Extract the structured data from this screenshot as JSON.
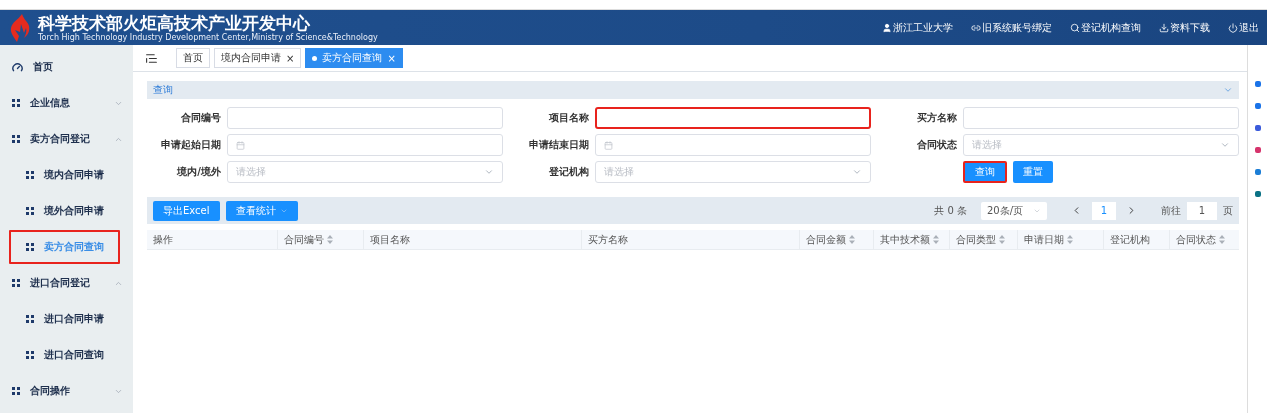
{
  "header": {
    "title": "科学技术部火炬高技术产业开发中心",
    "subtitle": "Torch High Technology Industry Development Center,Ministry of Science&Technology",
    "links": [
      {
        "kind": "user",
        "label": "浙江工业大学"
      },
      {
        "kind": "link",
        "label": "旧系统账号绑定"
      },
      {
        "kind": "search",
        "label": "登记机构查询"
      },
      {
        "kind": "download",
        "label": "资料下载"
      },
      {
        "kind": "power",
        "label": "退出"
      }
    ]
  },
  "sidebar": {
    "items": [
      {
        "kind": "home",
        "label": "首页",
        "selected": false,
        "highlighted": false
      },
      {
        "kind": "module",
        "label": "企业信息",
        "expanded": false,
        "selected": false,
        "highlighted": false
      },
      {
        "kind": "module",
        "label": "卖方合同登记",
        "expanded": true,
        "selected": false,
        "highlighted": false,
        "children": [
          {
            "kind": "module",
            "label": "境内合同申请",
            "selected": false,
            "highlighted": false
          },
          {
            "kind": "module",
            "label": "境外合同申请",
            "selected": false,
            "highlighted": false
          },
          {
            "kind": "module",
            "label": "卖方合同查询",
            "selected": true,
            "highlighted": true
          }
        ]
      },
      {
        "kind": "module",
        "label": "进口合同登记",
        "expanded": true,
        "selected": false,
        "highlighted": false,
        "children": [
          {
            "kind": "module",
            "label": "进口合同申请",
            "selected": false,
            "highlighted": false
          },
          {
            "kind": "module",
            "label": "进口合同查询",
            "selected": false,
            "highlighted": false
          }
        ]
      },
      {
        "kind": "module",
        "label": "合同操作",
        "expanded": false,
        "selected": false,
        "highlighted": false
      }
    ]
  },
  "tabs": [
    {
      "label": "首页",
      "selected": false
    },
    {
      "label": "境内合同申请",
      "selected": false,
      "close": "×"
    },
    {
      "label": "卖方合同查询",
      "selected": true,
      "close": "×"
    }
  ],
  "query": {
    "title": "查询",
    "fields": [
      {
        "kind": "text",
        "label": "合同编号",
        "highlighted": false
      },
      {
        "kind": "text",
        "label": "项目名称",
        "highlighted": true
      },
      {
        "kind": "text",
        "label": "买方名称",
        "highlighted": false
      },
      {
        "kind": "date",
        "label": "申请起始日期",
        "highlighted": false
      },
      {
        "kind": "date",
        "label": "申请结束日期",
        "highlighted": false
      },
      {
        "kind": "select",
        "label": "合同状态",
        "placeholder": "请选择",
        "highlighted": false
      },
      {
        "kind": "select",
        "label": "境内/境外",
        "placeholder": "请选择",
        "highlighted": false
      },
      {
        "kind": "select",
        "label": "登记机构",
        "placeholder": "请选择",
        "highlighted": false
      }
    ],
    "buttons": [
      {
        "label": "查询",
        "highlighted": true
      },
      {
        "label": "重置",
        "highlighted": false
      }
    ]
  },
  "toolbar": {
    "buttons": [
      {
        "kind": "plain",
        "label": "导出Excel"
      },
      {
        "kind": "dropdown",
        "label": "查看统计"
      }
    ],
    "pagination": {
      "total": "共 0 条",
      "page_size": "20条/页",
      "current_page": "1",
      "goto_label": "前往",
      "goto_value": "1",
      "page_unit": "页"
    }
  },
  "table": {
    "columns": [
      {
        "label": "操作",
        "sortable": false
      },
      {
        "label": "合同编号",
        "sortable": true
      },
      {
        "label": "项目名称",
        "sortable": false
      },
      {
        "label": "买方名称",
        "sortable": false
      },
      {
        "label": "合同金额",
        "sortable": true
      },
      {
        "label": "其中技术额",
        "sortable": true
      },
      {
        "label": "合同类型",
        "sortable": true
      },
      {
        "label": "申请日期",
        "sortable": true
      },
      {
        "label": "登记机构",
        "sortable": false
      },
      {
        "label": "合同状态",
        "sortable": true
      }
    ]
  }
}
